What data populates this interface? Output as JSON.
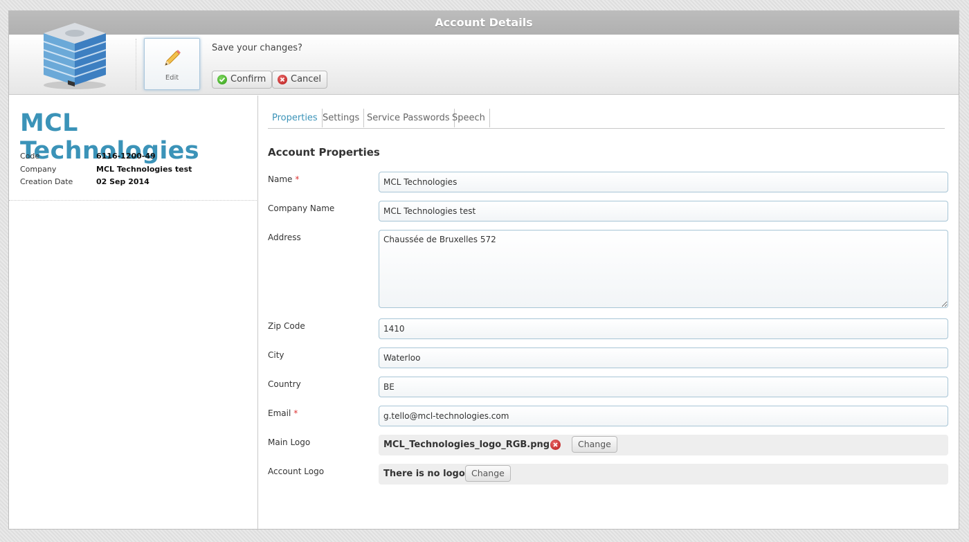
{
  "window": {
    "title": "Account Details"
  },
  "toolbar": {
    "building_icon": "office-building-icon",
    "edit_label": "Edit",
    "save_message": "Save your changes?",
    "confirm_label": "Confirm",
    "cancel_label": "Cancel"
  },
  "account": {
    "title": "MCL Technologies",
    "info": [
      {
        "key": "Code",
        "value": "6116-1200-49"
      },
      {
        "key": "Company",
        "value": "MCL Technologies test"
      },
      {
        "key": "Creation Date",
        "value": "02 Sep 2014"
      }
    ]
  },
  "tabs": [
    {
      "label": "Properties",
      "active": true
    },
    {
      "label": "Settings",
      "active": false
    },
    {
      "label": "Service Passwords",
      "active": false
    },
    {
      "label": "Speech",
      "active": false
    }
  ],
  "section": {
    "title": "Account Properties"
  },
  "form": {
    "name": {
      "label": "Name",
      "required_mark": "*",
      "value": "MCL Technologies"
    },
    "company_name": {
      "label": "Company Name",
      "value": "MCL Technologies test"
    },
    "address": {
      "label": "Address",
      "value": "Chaussée de Bruxelles 572"
    },
    "zip": {
      "label": "Zip Code",
      "value": "1410"
    },
    "city": {
      "label": "City",
      "value": "Waterloo"
    },
    "country": {
      "label": "Country",
      "value": "BE"
    },
    "email": {
      "label": "Email",
      "required_mark": "*",
      "value": "g.tello@mcl-technologies.com"
    },
    "main_logo": {
      "label": "Main Logo",
      "filename": "MCL_Technologies_logo_RGB.png",
      "change_label": "Change"
    },
    "account_logo": {
      "label": "Account Logo",
      "filename": "There is no logo",
      "change_label": "Change"
    }
  },
  "colors": {
    "accent": "#3b93b8",
    "required": "#dd3333",
    "confirm": "#2f9c12",
    "cancel": "#b51818"
  }
}
